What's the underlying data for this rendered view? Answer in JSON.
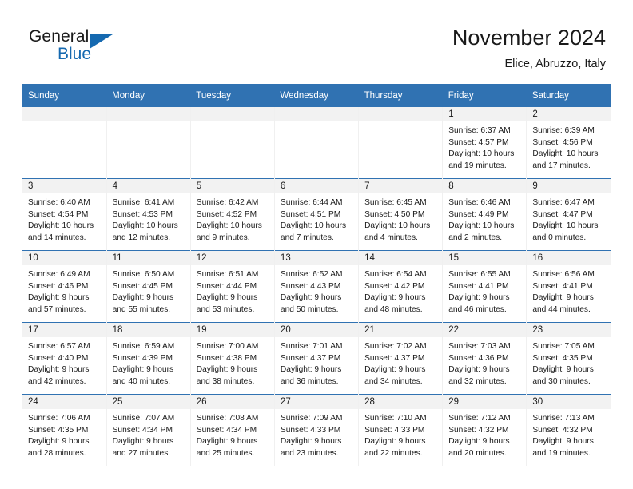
{
  "brand": {
    "name_top": "General",
    "name_bottom": "Blue",
    "triangle_color": "#1569b0",
    "text_color": "#1a1a1a"
  },
  "header": {
    "title": "November 2024",
    "subtitle": "Elice, Abruzzo, Italy"
  },
  "theme": {
    "header_blue": "#3072b2",
    "daynum_band": "#f2f2f2",
    "page_background": "#ffffff",
    "text": "#1a1a1a"
  },
  "weekday_headers": [
    "Sunday",
    "Monday",
    "Tuesday",
    "Wednesday",
    "Thursday",
    "Friday",
    "Saturday"
  ],
  "labels": {
    "sunrise_prefix": "Sunrise:",
    "sunset_prefix": "Sunset:",
    "daylight_prefix": "Daylight:"
  },
  "weeks": [
    [
      {
        "day": "",
        "empty": true,
        "sunrise": "",
        "sunset": "",
        "daylight": ""
      },
      {
        "day": "",
        "empty": true,
        "sunrise": "",
        "sunset": "",
        "daylight": ""
      },
      {
        "day": "",
        "empty": true,
        "sunrise": "",
        "sunset": "",
        "daylight": ""
      },
      {
        "day": "",
        "empty": true,
        "sunrise": "",
        "sunset": "",
        "daylight": ""
      },
      {
        "day": "",
        "empty": true,
        "sunrise": "",
        "sunset": "",
        "daylight": ""
      },
      {
        "day": "1",
        "empty": false,
        "sunrise": "Sunrise: 6:37 AM",
        "sunset": "Sunset: 4:57 PM",
        "daylight": "Daylight: 10 hours and 19 minutes."
      },
      {
        "day": "2",
        "empty": false,
        "sunrise": "Sunrise: 6:39 AM",
        "sunset": "Sunset: 4:56 PM",
        "daylight": "Daylight: 10 hours and 17 minutes."
      }
    ],
    [
      {
        "day": "3",
        "empty": false,
        "sunrise": "Sunrise: 6:40 AM",
        "sunset": "Sunset: 4:54 PM",
        "daylight": "Daylight: 10 hours and 14 minutes."
      },
      {
        "day": "4",
        "empty": false,
        "sunrise": "Sunrise: 6:41 AM",
        "sunset": "Sunset: 4:53 PM",
        "daylight": "Daylight: 10 hours and 12 minutes."
      },
      {
        "day": "5",
        "empty": false,
        "sunrise": "Sunrise: 6:42 AM",
        "sunset": "Sunset: 4:52 PM",
        "daylight": "Daylight: 10 hours and 9 minutes."
      },
      {
        "day": "6",
        "empty": false,
        "sunrise": "Sunrise: 6:44 AM",
        "sunset": "Sunset: 4:51 PM",
        "daylight": "Daylight: 10 hours and 7 minutes."
      },
      {
        "day": "7",
        "empty": false,
        "sunrise": "Sunrise: 6:45 AM",
        "sunset": "Sunset: 4:50 PM",
        "daylight": "Daylight: 10 hours and 4 minutes."
      },
      {
        "day": "8",
        "empty": false,
        "sunrise": "Sunrise: 6:46 AM",
        "sunset": "Sunset: 4:49 PM",
        "daylight": "Daylight: 10 hours and 2 minutes."
      },
      {
        "day": "9",
        "empty": false,
        "sunrise": "Sunrise: 6:47 AM",
        "sunset": "Sunset: 4:47 PM",
        "daylight": "Daylight: 10 hours and 0 minutes."
      }
    ],
    [
      {
        "day": "10",
        "empty": false,
        "sunrise": "Sunrise: 6:49 AM",
        "sunset": "Sunset: 4:46 PM",
        "daylight": "Daylight: 9 hours and 57 minutes."
      },
      {
        "day": "11",
        "empty": false,
        "sunrise": "Sunrise: 6:50 AM",
        "sunset": "Sunset: 4:45 PM",
        "daylight": "Daylight: 9 hours and 55 minutes."
      },
      {
        "day": "12",
        "empty": false,
        "sunrise": "Sunrise: 6:51 AM",
        "sunset": "Sunset: 4:44 PM",
        "daylight": "Daylight: 9 hours and 53 minutes."
      },
      {
        "day": "13",
        "empty": false,
        "sunrise": "Sunrise: 6:52 AM",
        "sunset": "Sunset: 4:43 PM",
        "daylight": "Daylight: 9 hours and 50 minutes."
      },
      {
        "day": "14",
        "empty": false,
        "sunrise": "Sunrise: 6:54 AM",
        "sunset": "Sunset: 4:42 PM",
        "daylight": "Daylight: 9 hours and 48 minutes."
      },
      {
        "day": "15",
        "empty": false,
        "sunrise": "Sunrise: 6:55 AM",
        "sunset": "Sunset: 4:41 PM",
        "daylight": "Daylight: 9 hours and 46 minutes."
      },
      {
        "day": "16",
        "empty": false,
        "sunrise": "Sunrise: 6:56 AM",
        "sunset": "Sunset: 4:41 PM",
        "daylight": "Daylight: 9 hours and 44 minutes."
      }
    ],
    [
      {
        "day": "17",
        "empty": false,
        "sunrise": "Sunrise: 6:57 AM",
        "sunset": "Sunset: 4:40 PM",
        "daylight": "Daylight: 9 hours and 42 minutes."
      },
      {
        "day": "18",
        "empty": false,
        "sunrise": "Sunrise: 6:59 AM",
        "sunset": "Sunset: 4:39 PM",
        "daylight": "Daylight: 9 hours and 40 minutes."
      },
      {
        "day": "19",
        "empty": false,
        "sunrise": "Sunrise: 7:00 AM",
        "sunset": "Sunset: 4:38 PM",
        "daylight": "Daylight: 9 hours and 38 minutes."
      },
      {
        "day": "20",
        "empty": false,
        "sunrise": "Sunrise: 7:01 AM",
        "sunset": "Sunset: 4:37 PM",
        "daylight": "Daylight: 9 hours and 36 minutes."
      },
      {
        "day": "21",
        "empty": false,
        "sunrise": "Sunrise: 7:02 AM",
        "sunset": "Sunset: 4:37 PM",
        "daylight": "Daylight: 9 hours and 34 minutes."
      },
      {
        "day": "22",
        "empty": false,
        "sunrise": "Sunrise: 7:03 AM",
        "sunset": "Sunset: 4:36 PM",
        "daylight": "Daylight: 9 hours and 32 minutes."
      },
      {
        "day": "23",
        "empty": false,
        "sunrise": "Sunrise: 7:05 AM",
        "sunset": "Sunset: 4:35 PM",
        "daylight": "Daylight: 9 hours and 30 minutes."
      }
    ],
    [
      {
        "day": "24",
        "empty": false,
        "sunrise": "Sunrise: 7:06 AM",
        "sunset": "Sunset: 4:35 PM",
        "daylight": "Daylight: 9 hours and 28 minutes."
      },
      {
        "day": "25",
        "empty": false,
        "sunrise": "Sunrise: 7:07 AM",
        "sunset": "Sunset: 4:34 PM",
        "daylight": "Daylight: 9 hours and 27 minutes."
      },
      {
        "day": "26",
        "empty": false,
        "sunrise": "Sunrise: 7:08 AM",
        "sunset": "Sunset: 4:34 PM",
        "daylight": "Daylight: 9 hours and 25 minutes."
      },
      {
        "day": "27",
        "empty": false,
        "sunrise": "Sunrise: 7:09 AM",
        "sunset": "Sunset: 4:33 PM",
        "daylight": "Daylight: 9 hours and 23 minutes."
      },
      {
        "day": "28",
        "empty": false,
        "sunrise": "Sunrise: 7:10 AM",
        "sunset": "Sunset: 4:33 PM",
        "daylight": "Daylight: 9 hours and 22 minutes."
      },
      {
        "day": "29",
        "empty": false,
        "sunrise": "Sunrise: 7:12 AM",
        "sunset": "Sunset: 4:32 PM",
        "daylight": "Daylight: 9 hours and 20 minutes."
      },
      {
        "day": "30",
        "empty": false,
        "sunrise": "Sunrise: 7:13 AM",
        "sunset": "Sunset: 4:32 PM",
        "daylight": "Daylight: 9 hours and 19 minutes."
      }
    ]
  ]
}
